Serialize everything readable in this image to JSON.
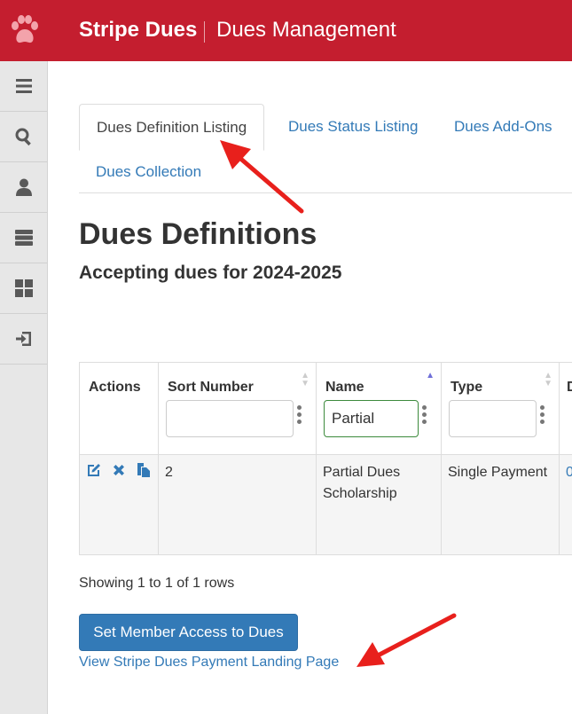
{
  "header": {
    "brand": "Stripe Dues",
    "page": "Dues Management",
    "color": "#c41e2f"
  },
  "sidebar": {
    "items": [
      {
        "icon": "menu-icon"
      },
      {
        "icon": "search-icon"
      },
      {
        "icon": "user-icon"
      },
      {
        "icon": "server-icon"
      },
      {
        "icon": "dashboard-icon"
      },
      {
        "icon": "sign-in-icon"
      }
    ]
  },
  "tabs": [
    {
      "label": "Dues Definition Listing",
      "active": true
    },
    {
      "label": "Dues Status Listing",
      "active": false
    },
    {
      "label": "Dues Add-Ons",
      "active": false
    },
    {
      "label": "Dues Collection",
      "active": false
    }
  ],
  "main": {
    "title": "Dues Definitions",
    "subtitle": "Accepting dues for 2024-2025"
  },
  "table": {
    "columns": [
      {
        "label": "Actions"
      },
      {
        "label": "Sort Number",
        "filter": ""
      },
      {
        "label": "Name",
        "filter": "Partial"
      },
      {
        "label": "Type",
        "filter": ""
      },
      {
        "label": "D"
      }
    ],
    "rows": [
      {
        "sort_number": "2",
        "name": "Partial Dues Scholarship",
        "type": "Single Payment",
        "extra": "0"
      }
    ],
    "showing": "Showing 1 to 1 of 1 rows"
  },
  "actions": {
    "set_access": "Set Member Access to Dues",
    "view_landing": "View Stripe Dues Payment Landing Page"
  },
  "annotation_color": "#e8201c"
}
